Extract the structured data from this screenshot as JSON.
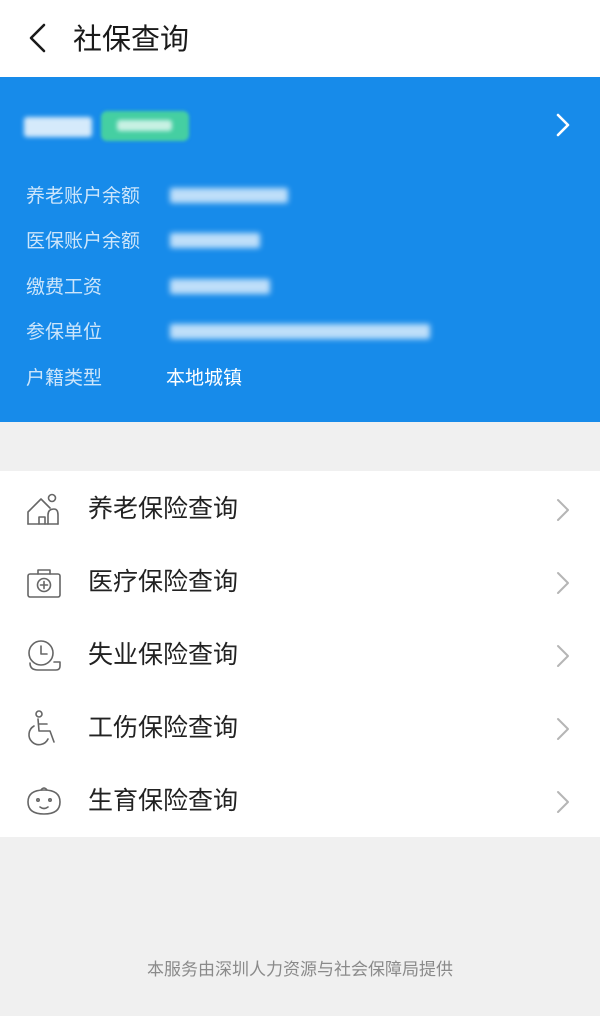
{
  "header": {
    "title": "社保查询",
    "back_icon": "chevron-left-icon"
  },
  "account_card": {
    "background_color": "#178bea",
    "badge_color": "#45cfa2",
    "rows": [
      {
        "label": "养老账户余额",
        "value": ""
      },
      {
        "label": "医保账户余额",
        "value": ""
      },
      {
        "label": "缴费工资",
        "value": ""
      },
      {
        "label": "参保单位",
        "value": ""
      },
      {
        "label": "户籍类型",
        "value": "本地城镇"
      }
    ]
  },
  "menu": {
    "items": [
      {
        "label": "养老保险查询",
        "icon": "elderly-house-icon"
      },
      {
        "label": "医疗保险查询",
        "icon": "medical-kit-icon"
      },
      {
        "label": "失业保险查询",
        "icon": "unemployment-clock-icon"
      },
      {
        "label": "工伤保险查询",
        "icon": "wheelchair-icon"
      },
      {
        "label": "生育保险查询",
        "icon": "baby-face-icon"
      }
    ]
  },
  "footer": {
    "text": "本服务由深圳人力资源与社会保障局提供"
  }
}
